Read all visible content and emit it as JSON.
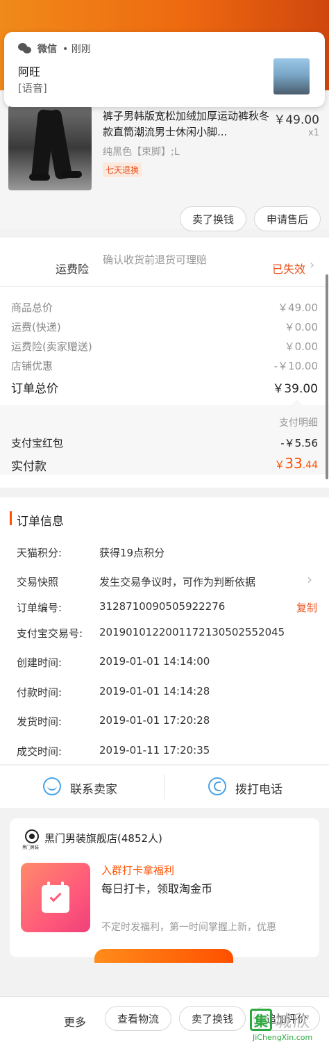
{
  "notification": {
    "app": "微信",
    "time": "• 刚刚",
    "title": "阿旺",
    "body": "[语音]"
  },
  "product": {
    "title": "裤子男韩版宽松加绒加厚运动裤秋冬款直筒潮流男士休闲小脚...",
    "price": "￥49.00",
    "qty": "x1",
    "sku": "纯黑色【束脚】;L",
    "tag": "七天退换",
    "btn_sell": "卖了换钱",
    "btn_after_sale": "申请售后"
  },
  "insurance": {
    "label": "运费险",
    "desc": "确认收货前退货可理赔",
    "status": "已失效",
    "status_color": "#e8541e"
  },
  "price_detail": {
    "rows": [
      {
        "label": "商品总价",
        "value": "￥49.00"
      },
      {
        "label": "运费(快递)",
        "value": "￥0.00"
      },
      {
        "label": "运费险(卖家赠送)",
        "value": "￥0.00"
      },
      {
        "label": "店铺优惠",
        "value": "-￥10.00"
      }
    ],
    "total_label": "订单总价",
    "total_value": "￥39.00",
    "pay_detail_link": "支付明细",
    "alipay_label": "支付宝红包",
    "alipay_value": "-￥5.56",
    "paid_label": "实付款",
    "paid_symbol": "￥",
    "paid_int": "33",
    "paid_dec": ".44",
    "paid_color": "#ff5000"
  },
  "order_info": {
    "title": "订单信息",
    "points_label": "天猫积分:",
    "points_value": "获得19点积分",
    "snapshot_label": "交易快照",
    "snapshot_value": "发生交易争议时，可作为判断依据",
    "order_no_label": "订单编号:",
    "order_no_value": "3128710090505922276",
    "copy_label": "复制",
    "alipay_no_label": "支付宝交易号:",
    "alipay_no_value": "2019010122001172130502552045",
    "created_label": "创建时间:",
    "created_value": "2019-01-01 14:14:00",
    "paid_label": "付款时间:",
    "paid_value": "2019-01-01 14:14:28",
    "shipped_label": "发货时间:",
    "shipped_value": "2019-01-01 17:20:28",
    "closed_label": "成交时间:",
    "closed_value": "2019-01-11 17:20:35"
  },
  "contact": {
    "seller": "联系卖家",
    "phone": "拨打电话"
  },
  "group": {
    "store_name": "黑门男装旗舰店(4852人)",
    "logo_text": "黑门男装",
    "promo_title": "入群打卡拿福利",
    "promo_subtitle": "每日打卡，领取淘金币",
    "promo_desc": "不定时发福利，第一时间掌握上新，优惠"
  },
  "bottom": {
    "more": "更多",
    "logistics": "查看物流",
    "sell": "卖了换钱",
    "review": "追加评价"
  },
  "watermark": {
    "logo": "集",
    "text": "城欣",
    "url": "JiChengXin.com"
  }
}
